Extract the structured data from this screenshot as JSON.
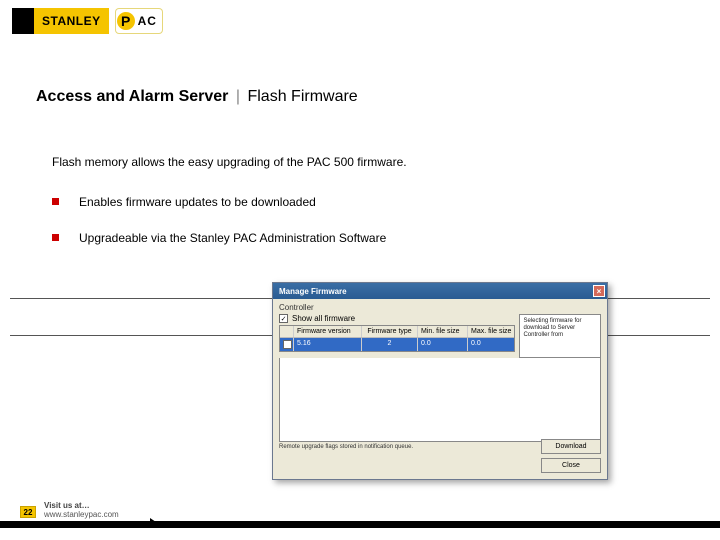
{
  "logo": {
    "brand": "STANLEY",
    "sub_initial": "P",
    "sub_rest": "AC"
  },
  "heading": {
    "bold": "Access and Alarm Server",
    "sep": "|",
    "sub": "Flash Firmware"
  },
  "intro": "Flash memory allows the easy upgrading of the PAC 500 firmware.",
  "bullets": [
    "Enables firmware updates to be downloaded",
    "Upgradeable via the Stanley PAC Administration Software"
  ],
  "dialog": {
    "title": "Manage Firmware",
    "section": "Controller",
    "checkbox_label": "Show all firmware",
    "help_text": "Selecting firmware for download to Server Controller from",
    "columns": [
      "",
      "Firmware version",
      "Firmware type",
      "Min. file size",
      "Max. file size"
    ],
    "row": {
      "version": "5.16",
      "type": "2",
      "min": "0.0",
      "max": "0.0"
    },
    "status": "Remote upgrade flags stored in notification queue.",
    "btn_download": "Download",
    "btn_close": "Close"
  },
  "footer": {
    "page": "22",
    "visit_label": "Visit us at…",
    "url": "www.stanleypac.com"
  }
}
